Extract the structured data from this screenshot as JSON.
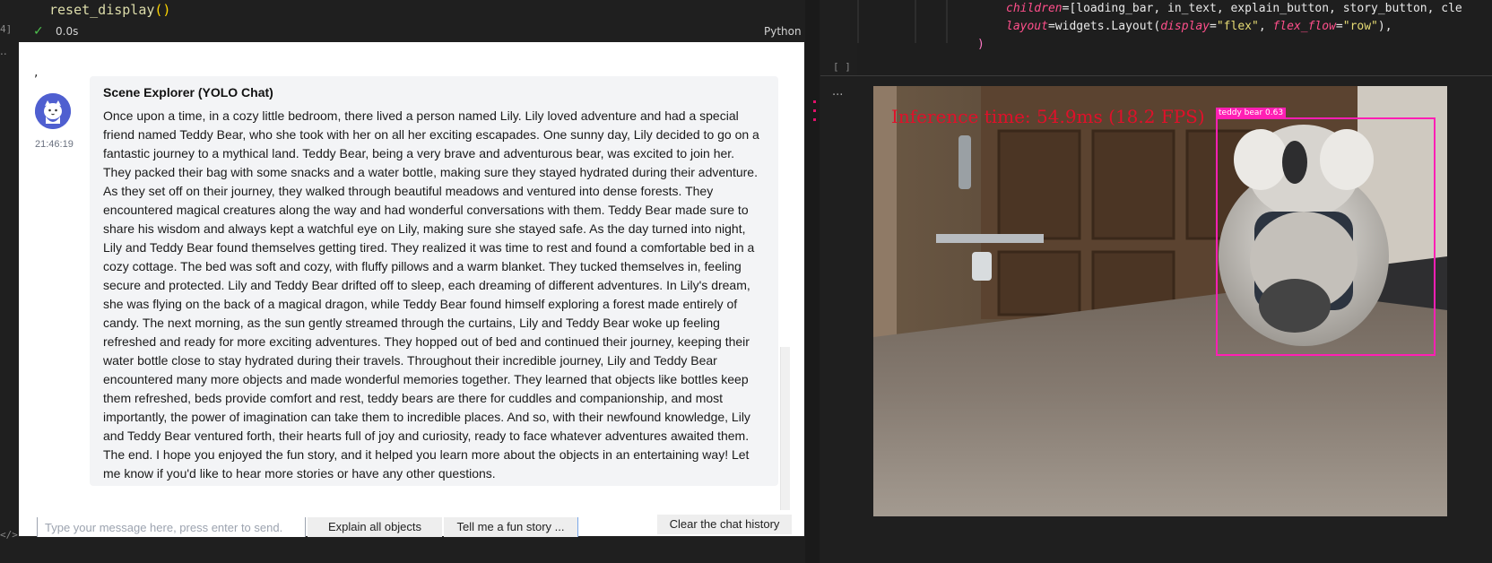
{
  "notebook_left": {
    "code_line": "reset_display",
    "code_parens": "()",
    "cell_number": "4]",
    "exec_status_icon": "check-icon",
    "exec_time": "0.0s",
    "language": "Python",
    "dots": "..",
    "gutter_mark": "</>"
  },
  "chat": {
    "comma": ",",
    "avatar_icon": "cat-avatar-icon",
    "timestamp": "21:46:19",
    "sender": "Scene Explorer (YOLO Chat)",
    "message": "Once upon a time, in a cozy little bedroom, there lived a person named Lily. Lily loved adventure and had a special friend named Teddy Bear, who she took with her on all her exciting escapades. One sunny day, Lily decided to go on a fantastic journey to a mythical land. Teddy Bear, being a very brave and adventurous bear, was excited to join her. They packed their bag with some snacks and a water bottle, making sure they stayed hydrated during their adventure. As they set off on their journey, they walked through beautiful meadows and ventured into dense forests. They encountered magical creatures along the way and had wonderful conversations with them. Teddy Bear made sure to share his wisdom and always kept a watchful eye on Lily, making sure she stayed safe. As the day turned into night, Lily and Teddy Bear found themselves getting tired. They realized it was time to rest and found a comfortable bed in a cozy cottage. The bed was soft and cozy, with fluffy pillows and a warm blanket. They tucked themselves in, feeling secure and protected. Lily and Teddy Bear drifted off to sleep, each dreaming of different adventures. In Lily's dream, she was flying on the back of a magical dragon, while Teddy Bear found himself exploring a forest made entirely of candy. The next morning, as the sun gently streamed through the curtains, Lily and Teddy Bear woke up feeling refreshed and ready for more exciting adventures. They hopped out of bed and continued their journey, keeping their water bottle close to stay hydrated during their travels. Throughout their incredible journey, Lily and Teddy Bear encountered many more objects and made wonderful memories together. They learned that objects like bottles keep them refreshed, beds provide comfort and rest, teddy bears are there for cuddles and companionship, and most importantly, the power of imagination can take them to incredible places. And so, with their newfound knowledge, Lily and Teddy Bear ventured forth, their hearts full of joy and curiosity, ready to face whatever adventures awaited them. The end. I hope you enjoyed the fun story, and it helped you learn more about the objects in an entertaining way! Let me know if you'd like to hear more stories or have any other questions.",
    "input_placeholder": "Type your message here, press enter to send.",
    "input_value": "",
    "buttons": {
      "explain": "Explain all objects",
      "story": "Tell me a fun story ...",
      "clear": "Clear the chat history"
    }
  },
  "notebook_right": {
    "code_line1": {
      "param": "children",
      "eq": "=",
      "value": "[loading_bar, in_text, explain_button, story_button, cle"
    },
    "code_line2": {
      "param": "layout",
      "eq": "=",
      "obj": "widgets",
      "dot": ".",
      "fn": "Layout(",
      "p1": "display",
      "v1": "\"flex\"",
      "sep": ", ",
      "p2": "flex_flow",
      "v2": "\"row\"",
      "end": "),"
    },
    "code_line3": ")",
    "empty_cell": "[ ]",
    "output_dots": "...",
    "camera": {
      "inference_text": "Inference time: 54.9ms (18.2 FPS)",
      "detection_label": "teddy bear 0.63",
      "detection_color": "#ff1fb4"
    }
  }
}
